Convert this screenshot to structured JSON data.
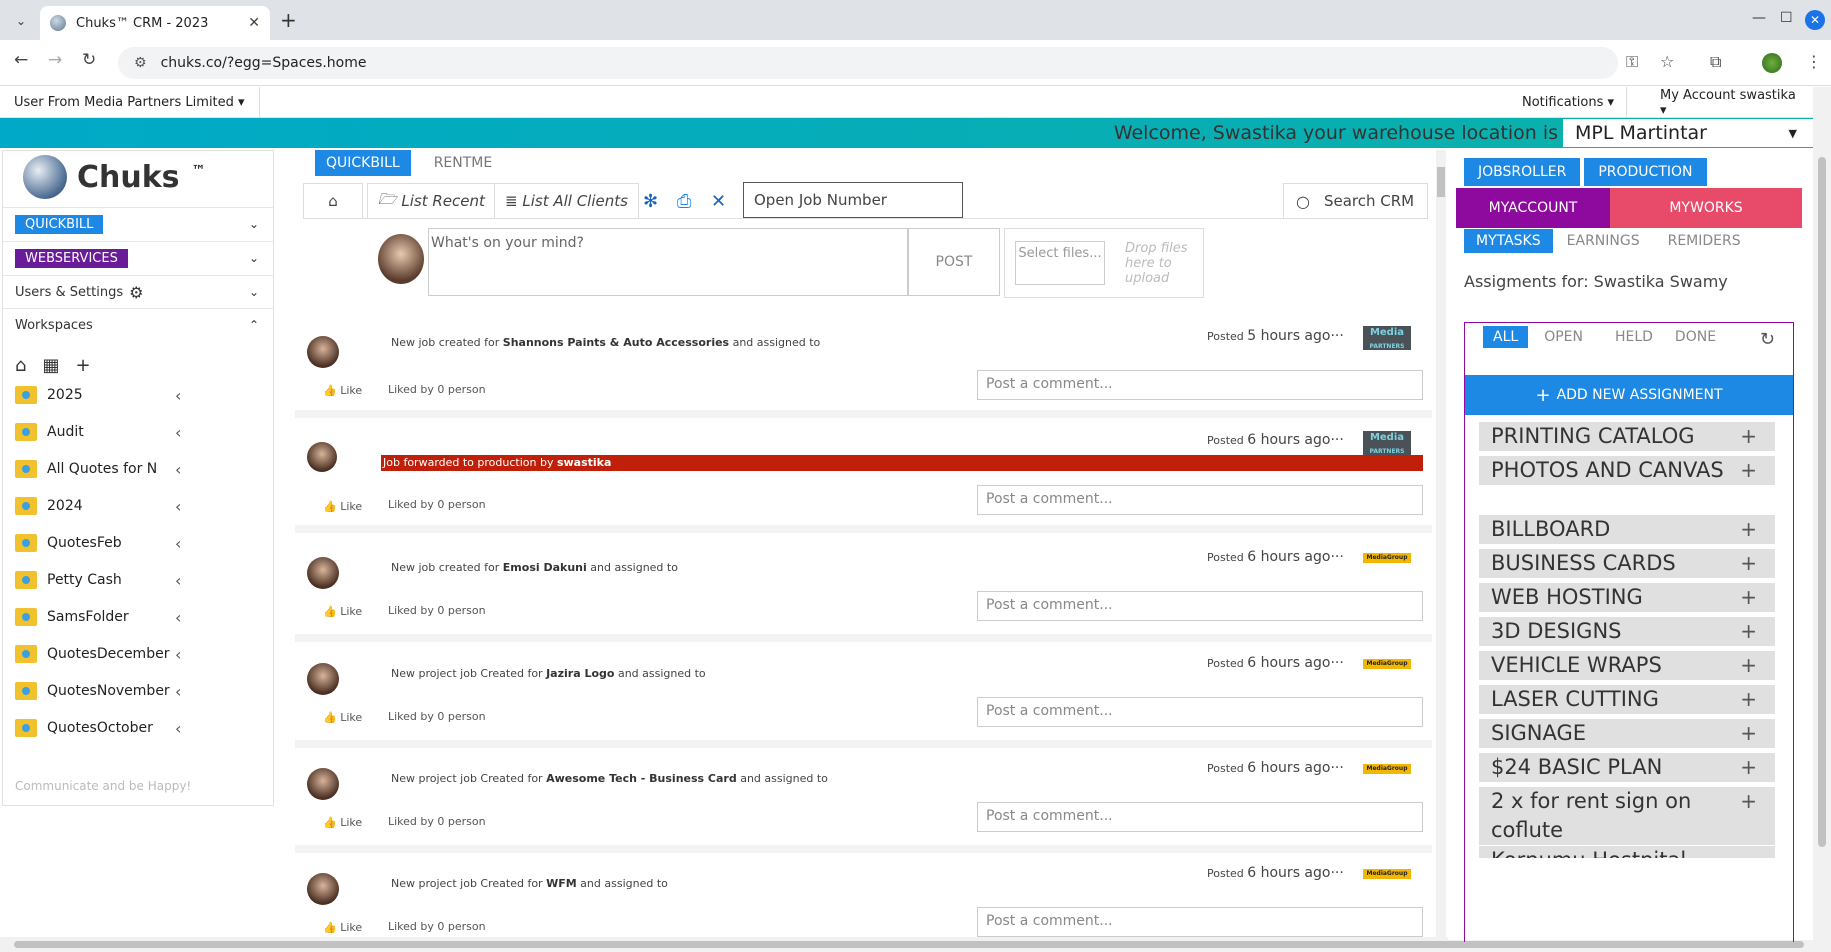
{
  "browser": {
    "tab_title": "Chuks™ CRM - 2023",
    "url": "chuks.co/?egg=Spaces.home"
  },
  "appbar": {
    "user": "User From Media Partners Limited ▾",
    "notifications": "Notifications ▾",
    "account": "My Account swastika ▾"
  },
  "welcome": {
    "message": "Welcome, Swastika your warehouse location is",
    "location": "MPL Martintar"
  },
  "sidebar": {
    "brand": "Chuks",
    "tm": "™",
    "quickbill": "QUICKBILL",
    "webservices": "WEBSERVICES",
    "users_settings": "Users & Settings",
    "workspaces": "Workspaces",
    "folders": [
      "2025",
      "Audit",
      "All Quotes for N",
      "2024",
      "QuotesFeb",
      "Petty Cash",
      "SamsFolder",
      "QuotesDecember",
      "QuotesNovember",
      "QuotesOctober"
    ],
    "footer": "Communicate and be Happy!"
  },
  "feed": {
    "tab_active": "QUICKBILL",
    "tab_other": "RENTME",
    "list_recent": "List Recent",
    "list_all": "List All Clients",
    "job_placeholder": "Open Job Number",
    "search": "Search CRM",
    "composer_placeholder": "What's on your mind?",
    "post_btn": "POST",
    "select_files": "Select files...",
    "drop_text": "Drop files here to upload",
    "like": "Like",
    "comment_placeholder": "Post a comment...",
    "posts": [
      {
        "pre": "New job created for ",
        "bold": "Shannons Paints & Auto Accessories",
        "post": " and assigned to",
        "posted": "Posted ",
        "ago": "5 hours ago···",
        "liked": "Liked by 0 person"
      },
      {
        "pre": "Job forwarded to production by ",
        "bold": "swastika",
        "post": "",
        "posted": "Posted ",
        "ago": "6 hours ago···",
        "liked": "Liked by 0 person"
      },
      {
        "pre": "New job created for ",
        "bold": "Emosi Dakuni",
        "post": " and assigned to",
        "posted": "Posted ",
        "ago": "6 hours ago···",
        "liked": "Liked by 0 person"
      },
      {
        "pre": "New project job Created for ",
        "bold": "Jazira Logo",
        "post": " and assigned to",
        "posted": "Posted ",
        "ago": "6 hours ago···",
        "liked": "Liked by 0 person"
      },
      {
        "pre": "New project job Created for ",
        "bold": "Awesome Tech - Business Card",
        "post": " and assigned to",
        "posted": "Posted ",
        "ago": "6 hours ago···",
        "liked": "Liked by 0 person"
      },
      {
        "pre": "New project job Created for ",
        "bold": "WFM",
        "post": " and assigned to",
        "posted": "Posted ",
        "ago": "6 hours ago···",
        "liked": "Liked by 0 person"
      }
    ]
  },
  "right": {
    "jobsroller": "JOBSROLLER",
    "production": "PRODUCTION",
    "myaccount": "MYACCOUNT",
    "myworks": "MYWORKS",
    "mytasks": "MYTASKS",
    "earnings": "EARNINGS",
    "reminders": "REMIDERS",
    "title": "Assigments for: Swastika Swamy",
    "f_all": "ALL",
    "f_open": "OPEN",
    "f_held": "HELD",
    "f_done": "DONE",
    "add_new": "ADD NEW ASSIGNMENT",
    "categories": [
      "PRINTING CATALOG",
      "PHOTOS AND CANVAS",
      "BILLBOARD",
      "BUSINESS CARDS",
      "WEB HOSTING",
      "3D DESIGNS",
      "VEHICLE WRAPS",
      "LASER CUTTING",
      "SIGNAGE",
      "$24 BASIC PLAN",
      "2 x for rent sign on coflute",
      "Korpumu Hostpital"
    ]
  }
}
